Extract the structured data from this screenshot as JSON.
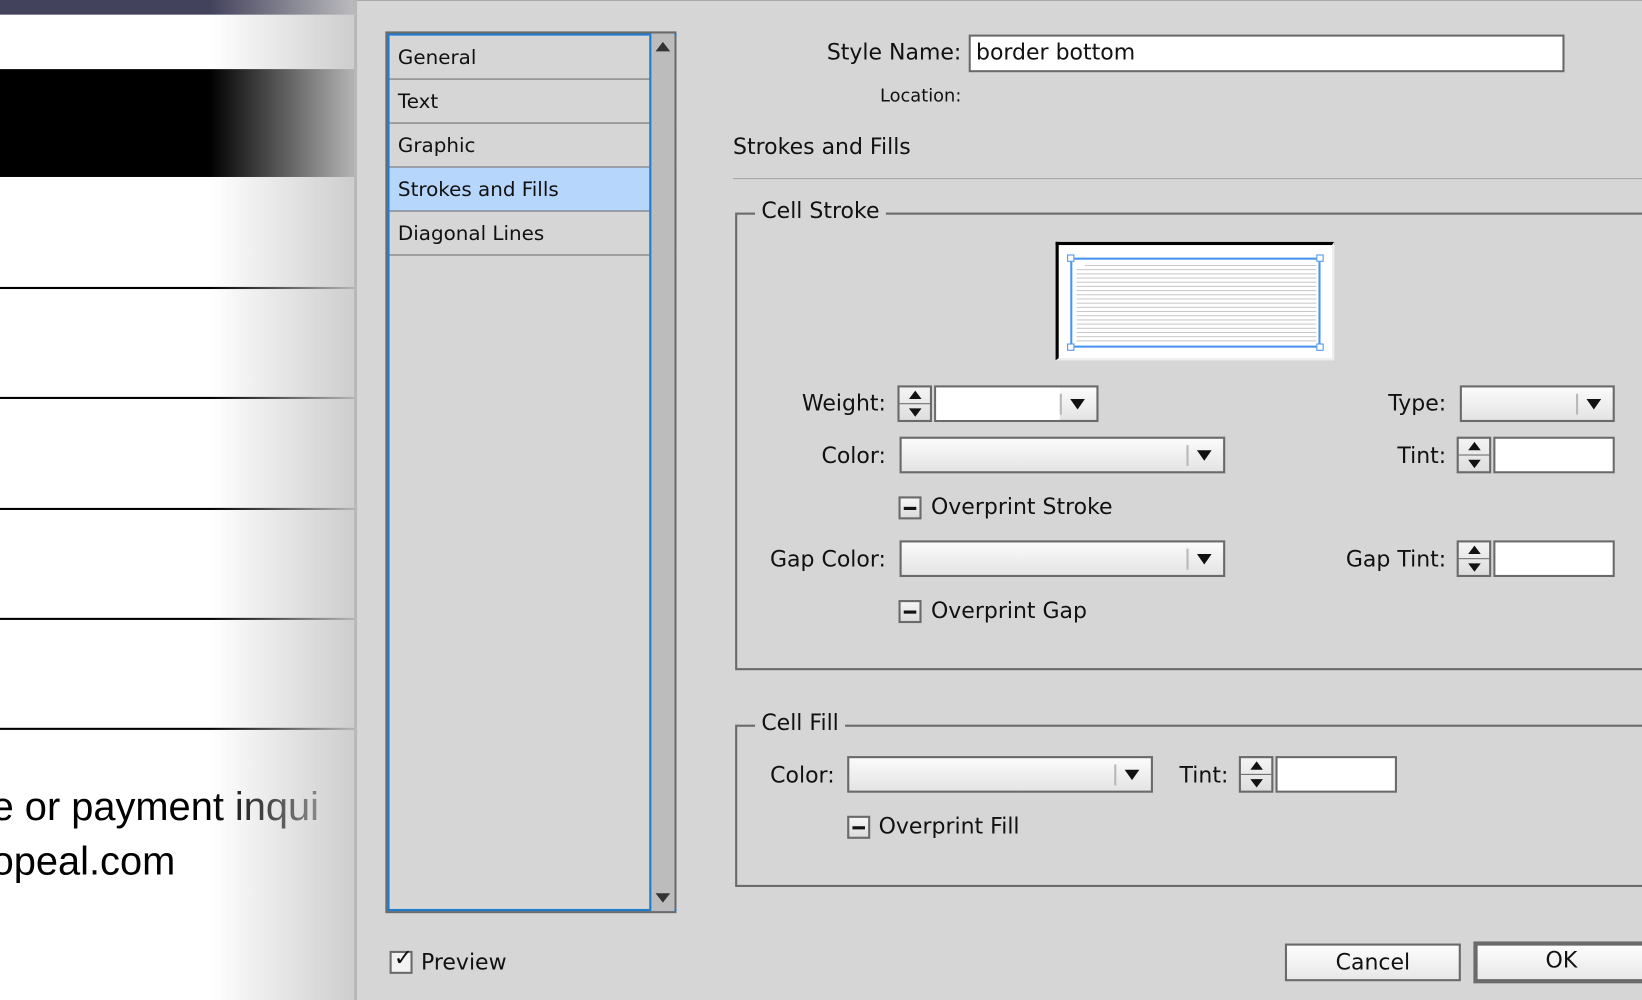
{
  "background_document": {
    "text_lines": [
      "e or payment inqui",
      "opeal.com"
    ]
  },
  "dialog": {
    "categories": [
      {
        "label": "General",
        "selected": false
      },
      {
        "label": "Text",
        "selected": false
      },
      {
        "label": "Graphic",
        "selected": false
      },
      {
        "label": "Strokes and Fills",
        "selected": true
      },
      {
        "label": "Diagonal Lines",
        "selected": false
      }
    ],
    "style_name_label": "Style Name:",
    "style_name_value": "border bottom",
    "location_label": "Location:",
    "location_value": "",
    "section_title": "Strokes and Fills",
    "cell_stroke": {
      "legend": "Cell Stroke",
      "weight_label": "Weight:",
      "weight_value": "",
      "type_label": "Type:",
      "type_value": "",
      "color_label": "Color:",
      "color_value": "",
      "tint_label": "Tint:",
      "tint_value": "",
      "overprint_stroke_label": "Overprint Stroke",
      "overprint_stroke_state": "mixed",
      "gap_color_label": "Gap Color:",
      "gap_color_value": "",
      "gap_tint_label": "Gap Tint:",
      "gap_tint_value": "",
      "overprint_gap_label": "Overprint Gap",
      "overprint_gap_state": "mixed"
    },
    "cell_fill": {
      "legend": "Cell Fill",
      "color_label": "Color:",
      "color_value": "",
      "tint_label": "Tint:",
      "tint_value": "",
      "overprint_fill_label": "Overprint Fill",
      "overprint_fill_state": "mixed"
    },
    "preview_label": "Preview",
    "preview_checked": true,
    "cancel_label": "Cancel",
    "ok_label": "OK"
  },
  "colors": {
    "selection_highlight": "#b7d6fb",
    "focus_ring": "#1f7bd0",
    "proxy_selection": "#4a94ee",
    "dialog_bg": "#d6d6d6"
  }
}
